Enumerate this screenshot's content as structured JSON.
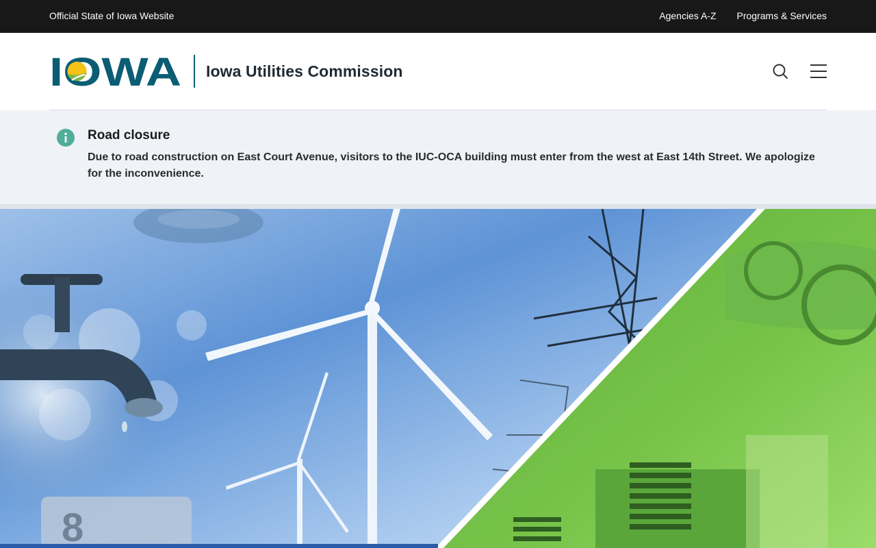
{
  "topbar": {
    "official_label": "Official State of Iowa Website",
    "links": [
      "Agencies A-Z",
      "Programs & Services"
    ]
  },
  "header": {
    "logo_text": "IOWA",
    "site_title": "Iowa Utilities Commission",
    "icons": {
      "search": "search-icon",
      "menu": "hamburger-menu-icon"
    }
  },
  "alert": {
    "icon": "info-icon",
    "title": "Road closure",
    "message": "Due to road construction on East Court Avenue, visitors to the IUC-OCA building must enter from the west at East 14th Street. We apologize for the inconvenience."
  },
  "colors": {
    "topbar_bg": "#181818",
    "brand_teal": "#0b5d73",
    "sun_yellow": "#f4c116",
    "leaf_green": "#7ab648",
    "info_icon": "#4fae9a",
    "alert_bg": "#eff2f6",
    "accent_blue": "#2a5aa8"
  }
}
